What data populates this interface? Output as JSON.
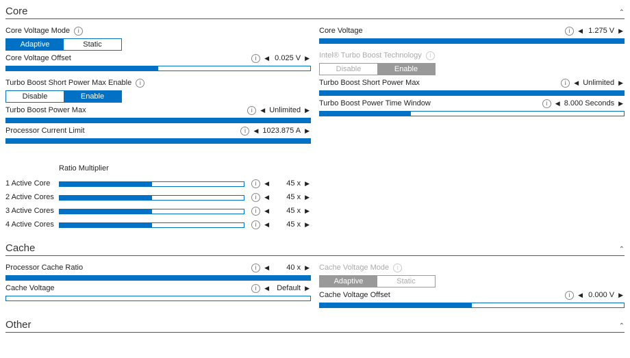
{
  "sections": {
    "core": {
      "title": "Core"
    },
    "cache": {
      "title": "Cache"
    },
    "other": {
      "title": "Other"
    }
  },
  "core": {
    "voltage_mode": {
      "label": "Core Voltage Mode",
      "opt_a": "Adaptive",
      "opt_b": "Static",
      "active": "a"
    },
    "voltage": {
      "label": "Core Voltage",
      "value": "1.275 V",
      "fill": 100
    },
    "voltage_offset": {
      "label": "Core Voltage Offset",
      "value": "0.025 V",
      "fill": 50
    },
    "turbo_tech": {
      "label": "Intel® Turbo Boost Technology",
      "opt_a": "Disable",
      "opt_b": "Enable",
      "active": "b"
    },
    "turbo_short_enable": {
      "label": "Turbo Boost Short Power Max Enable",
      "opt_a": "Disable",
      "opt_b": "Enable",
      "active": "b"
    },
    "turbo_short": {
      "label": "Turbo Boost Short Power Max",
      "value": "Unlimited",
      "fill": 100
    },
    "turbo_power_max": {
      "label": "Turbo Boost Power Max",
      "value": "Unlimited",
      "fill": 100
    },
    "turbo_time_window": {
      "label": "Turbo Boost Power Time Window",
      "value": "8.000 Seconds",
      "fill": 30
    },
    "current_limit": {
      "label": "Processor Current Limit",
      "value": "1023.875 A",
      "fill": 100
    },
    "ratio": {
      "header": "Ratio Multiplier",
      "rows": [
        {
          "label": "1 Active Core",
          "value": "45 x",
          "fill": 50
        },
        {
          "label": "2 Active Cores",
          "value": "45 x",
          "fill": 50
        },
        {
          "label": "3 Active Cores",
          "value": "45 x",
          "fill": 50
        },
        {
          "label": "4 Active Cores",
          "value": "45 x",
          "fill": 50
        }
      ]
    }
  },
  "cache": {
    "ratio": {
      "label": "Processor Cache Ratio",
      "value": "40 x",
      "fill": 100
    },
    "voltage_mode": {
      "label": "Cache Voltage Mode",
      "opt_a": "Adaptive",
      "opt_b": "Static",
      "active": "a"
    },
    "voltage": {
      "label": "Cache Voltage",
      "value": "Default",
      "fill": 0
    },
    "voltage_offset": {
      "label": "Cache Voltage Offset",
      "value": "0.000 V",
      "fill": 50
    }
  }
}
